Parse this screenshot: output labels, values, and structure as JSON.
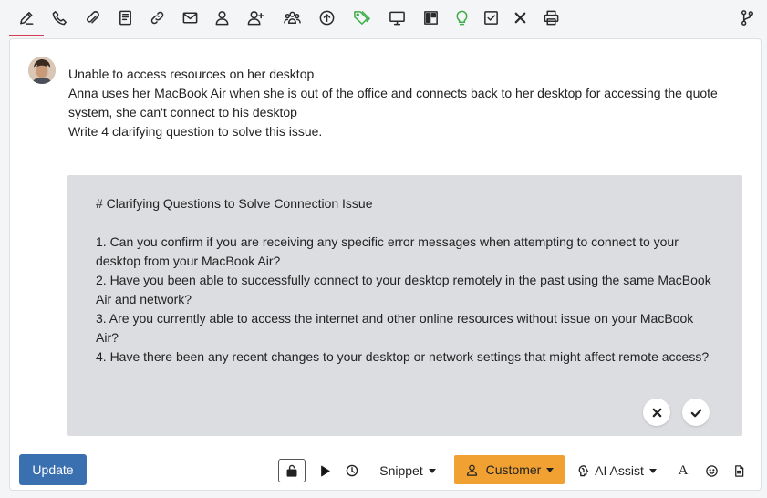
{
  "toolbar": {
    "items": [
      {
        "name": "edit-icon",
        "active": true
      },
      {
        "name": "phone-icon"
      },
      {
        "name": "paperclip-icon"
      },
      {
        "name": "book-icon"
      },
      {
        "name": "link-icon"
      },
      {
        "name": "envelope-icon"
      },
      {
        "name": "user-icon"
      },
      {
        "name": "user-plus-icon"
      },
      {
        "name": "users-icon"
      },
      {
        "name": "arrow-up-circle-icon"
      },
      {
        "name": "tags-icon",
        "color": "#3fae49"
      },
      {
        "name": "monitor-icon"
      },
      {
        "name": "layout-icon"
      },
      {
        "name": "lightbulb-icon",
        "color": "#3fae49"
      },
      {
        "name": "checkbox-icon"
      },
      {
        "name": "close-icon"
      },
      {
        "name": "printer-icon"
      },
      {
        "name": "branch-icon"
      }
    ],
    "active_indicator_color": "#d33a56"
  },
  "message": {
    "line1": "Unable to access resources on her desktop",
    "line2": "Anna uses her MacBook Air when she is out of the office and connects back to her desktop for accessing the quote system, she can't connect to his desktop",
    "line3": "Write 4 clarifying question to solve this issue."
  },
  "ai_response": {
    "text": "# Clarifying Questions to Solve Connection Issue\n\n1. Can you confirm if you are receiving any specific error messages when attempting to connect to your desktop from your MacBook Air?\n2. Have you been able to successfully connect to your desktop remotely in the past using the same MacBook Air and network?\n3. Are you currently able to access the internet and other online resources without issue on your MacBook Air?\n4. Have there been any recent changes to your desktop or network settings that might affect remote access?"
  },
  "bottom_bar": {
    "update_label": "Update",
    "snippet_label": "Snippet",
    "customer_label": "Customer",
    "ai_assist_label": "AI Assist",
    "font_label": "A",
    "update_color": "#3a6fb0",
    "customer_color": "#f0a132"
  }
}
